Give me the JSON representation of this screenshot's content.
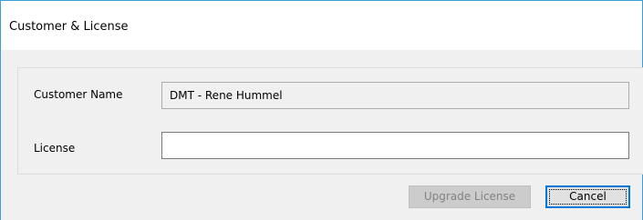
{
  "window": {
    "title": "Customer & License"
  },
  "form": {
    "customer_name": {
      "label": "Customer Name",
      "value": "DMT - Rene Hummel"
    },
    "license": {
      "label": "License",
      "value": "",
      "placeholder": ""
    }
  },
  "buttons": {
    "upgrade_label": "Upgrade License",
    "cancel_label": "Cancel"
  },
  "colors": {
    "window_border": "#3c9ed8",
    "focus_border": "#0078d7",
    "dialog_background": "#f0f0f0"
  }
}
